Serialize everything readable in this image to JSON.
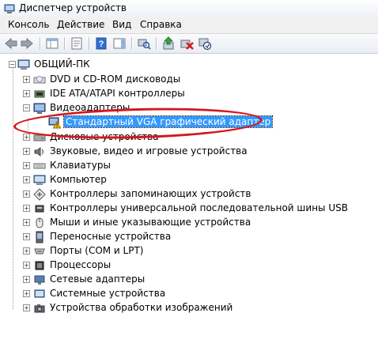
{
  "window": {
    "title": "Диспетчер устройств"
  },
  "menu": [
    "Консоль",
    "Действие",
    "Вид",
    "Справка"
  ],
  "toolbar": {
    "icons": [
      "back-icon",
      "forward-icon",
      "console-tree-icon",
      "properties-icon",
      "help-icon",
      "action-pane-icon",
      "scan-hardware-icon",
      "update-driver-icon",
      "uninstall-icon",
      "disable-icon"
    ]
  },
  "tree": {
    "root": "ОБЩИЙ-ПК",
    "items": [
      {
        "label": "DVD и CD-ROM дисководы",
        "icon": "dvd-drive-icon",
        "expanded": false
      },
      {
        "label": "IDE ATA/ATAPI контроллеры",
        "icon": "ide-controller-icon",
        "expanded": false
      },
      {
        "label": "Видеоадаптеры",
        "icon": "display-adapter-icon",
        "expanded": true
      },
      {
        "label": "Стандартный VGA графический адаптер",
        "icon": "warning-display-icon",
        "child": true,
        "selected": true
      },
      {
        "label": "Дисковые устройства",
        "icon": "disk-drive-icon",
        "expanded": false
      },
      {
        "label": "Звуковые, видео и игровые устройства",
        "icon": "sound-icon",
        "expanded": false
      },
      {
        "label": "Клавиатуры",
        "icon": "keyboard-icon",
        "expanded": false
      },
      {
        "label": "Компьютер",
        "icon": "computer-icon",
        "expanded": false
      },
      {
        "label": "Контроллеры запоминающих устройств",
        "icon": "storage-controller-icon",
        "expanded": false
      },
      {
        "label": "Контроллеры универсальной последовательной шины USB",
        "icon": "usb-icon",
        "expanded": false
      },
      {
        "label": "Мыши и иные указывающие устройства",
        "icon": "mouse-icon",
        "expanded": false
      },
      {
        "label": "Переносные устройства",
        "icon": "portable-device-icon",
        "expanded": false
      },
      {
        "label": "Порты (COM и LPT)",
        "icon": "port-icon",
        "expanded": false
      },
      {
        "label": "Процессоры",
        "icon": "processor-icon",
        "expanded": false
      },
      {
        "label": "Сетевые адаптеры",
        "icon": "network-adapter-icon",
        "expanded": false
      },
      {
        "label": "Системные устройства",
        "icon": "system-device-icon",
        "expanded": false
      },
      {
        "label": "Устройства обработки изображений",
        "icon": "imaging-device-icon",
        "expanded": false
      }
    ]
  },
  "colors": {
    "selection": "#3399ff",
    "annotation": "#d5161e",
    "warning": "#f5c400"
  }
}
